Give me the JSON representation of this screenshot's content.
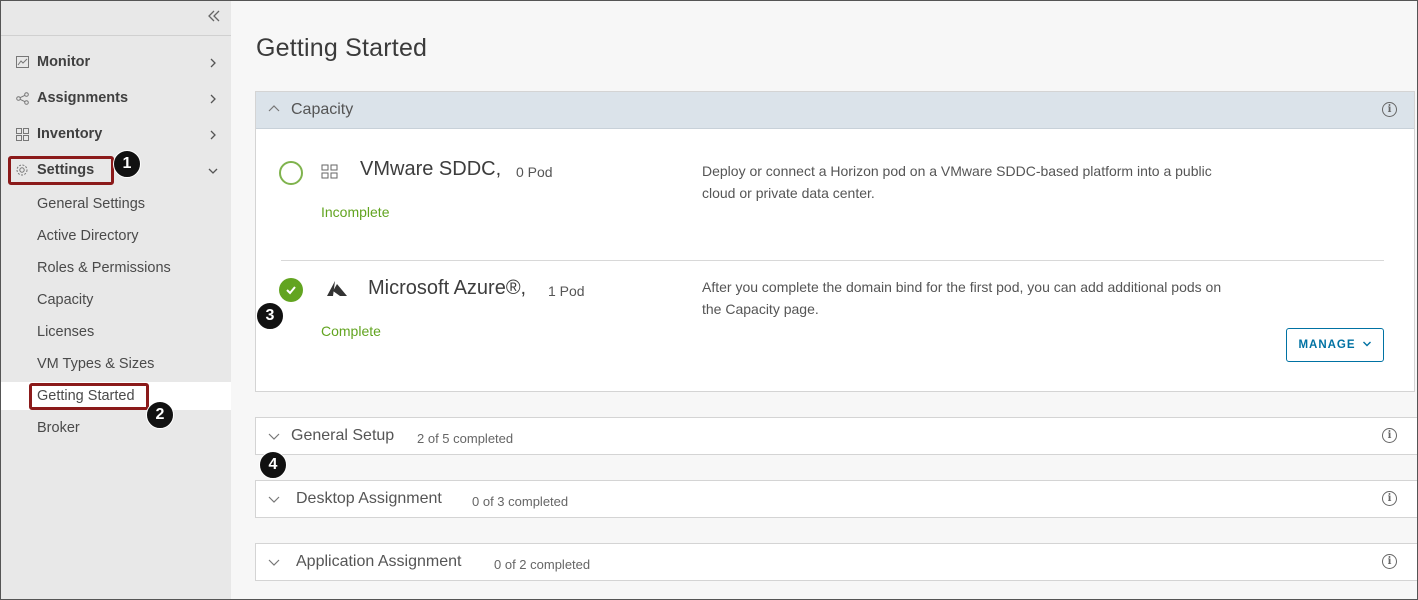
{
  "sidebar": {
    "collapse_icon": "double-chevron-left-icon",
    "nav": [
      {
        "label": "Monitor",
        "icon": "chart-icon"
      },
      {
        "label": "Assignments",
        "icon": "share-icon"
      },
      {
        "label": "Inventory",
        "icon": "grid-icon"
      },
      {
        "label": "Settings",
        "icon": "gear-icon"
      }
    ],
    "settings_items": [
      {
        "label": "General Settings"
      },
      {
        "label": "Active Directory"
      },
      {
        "label": "Roles & Permissions"
      },
      {
        "label": "Capacity"
      },
      {
        "label": "Licenses"
      },
      {
        "label": "VM Types & Sizes"
      },
      {
        "label": "Getting Started",
        "active": true
      },
      {
        "label": "Broker"
      }
    ]
  },
  "annotations": [
    "1",
    "2",
    "3",
    "4"
  ],
  "main": {
    "page_title": "Getting Started",
    "capacity": {
      "title": "Capacity",
      "pods": [
        {
          "name": "VMware SDDC,",
          "count": "0 Pod",
          "status": "Incomplete",
          "description": "Deploy or connect a Horizon pod on a VMware SDDC-based platform into a public cloud or private data center."
        },
        {
          "name": "Microsoft Azure®,",
          "count": "1 Pod",
          "status": "Complete",
          "description": "After you complete the domain bind for the first pod, you can add additional pods on the Capacity page."
        }
      ],
      "manage_label": "MANAGE"
    },
    "sections": [
      {
        "title": "General Setup",
        "count": "2 of 5 completed"
      },
      {
        "title": "Desktop Assignment",
        "count": "0 of 3 completed"
      },
      {
        "title": "Application Assignment",
        "count": "0 of 2 completed"
      }
    ]
  },
  "colors": {
    "accent": "#0072a3",
    "success": "#62a420",
    "annotation": "#8b1a1a",
    "sidebar_bg": "#e8e8e8",
    "panel_header": "#dbe3ea"
  }
}
